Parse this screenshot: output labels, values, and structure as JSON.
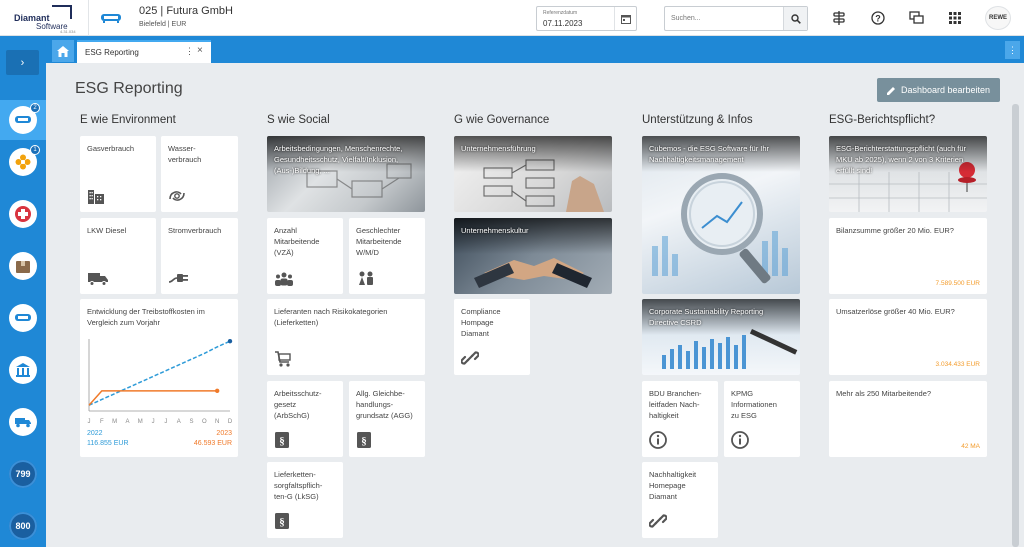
{
  "header": {
    "logo": {
      "line1": "Diamant",
      "line2": "Software",
      "version": "4.31.034"
    },
    "company": "025 | Futura GmbH",
    "company_sub": "Bielefeld | EUR",
    "ref_date_label": "Referenzdatum",
    "ref_date_value": "07.11.2023",
    "search_placeholder": "Suchen...",
    "user_badge": "REWE"
  },
  "sidebar": {
    "badges": [
      "2",
      "1"
    ],
    "numbers": [
      "799",
      "800"
    ]
  },
  "tabs": [
    {
      "label": "ESG Reporting"
    }
  ],
  "page": {
    "title": "ESG Reporting",
    "dashboard_button": "Dashboard bearbeiten"
  },
  "columns": {
    "environment": {
      "title": "E wie Environment",
      "tiles": [
        "Gasverbrauch",
        "Wasser-\nverbrauch",
        "LKW Diesel",
        "Stromverbrauch"
      ],
      "chart_tile": "Entwicklung der Treibstoffkosten im Vergleich zum Vorjahr"
    },
    "social": {
      "title": "S wie Social",
      "image_tile": "Arbeitsbedingungen, Menschenrechte, Gesundheitsschutz, Vielfalt/Inklusion, (Aus-)Bildung, ...",
      "tiles": [
        "Anzahl\nMitarbeitende\n(VZÄ)",
        "Geschlechter\nMitarbeitende\nW/M/D",
        "Lieferanten nach Risikokategorien (Lieferketten)",
        "Arbeitsschutz-\ngesetz\n(ArbSchG)",
        "Allg. Gleichbe-\nhandlungs-\ngrundsatz (AGG)",
        "Lieferketten-\nsorgfaltspflich-\nten-G (LkSG)"
      ]
    },
    "governance": {
      "title": "G wie Governance",
      "image_tiles": [
        "Unternehmensführung",
        "Unternehmenskultur"
      ],
      "tiles": [
        "Compliance\nHompage\nDiamant"
      ]
    },
    "support": {
      "title": "Unterstützung & Infos",
      "image_tiles": [
        "Cubemos - die ESG Software für Ihr Nachhaltigkeitsmanagement",
        "Corporate Sustainability Reporting Directive CSRD"
      ],
      "tiles": [
        "BDU Branchen-\nleitfaden Nach-\nhaltigkeit",
        "KPMG\nInformationen\nzu ESG",
        "Nachhaltigkeit\nHomepage\nDiamant"
      ]
    },
    "obligation": {
      "title": "ESG-Berichtspflicht?",
      "image_tile": "ESG-Berichterstattungspflicht (auch für MKU ab 2025), wenn 2 von 3 Kriterien erfüllt sind!",
      "tiles": [
        {
          "label": "Bilanzsumme größer 20 Mio. EUR?",
          "value": "7.589.500 EUR"
        },
        {
          "label": "Umsatzerlöse größer 40 Mio. EUR?",
          "value": "3.034.433 EUR"
        },
        {
          "label": "Mehr als 250 Mitarbeitende?",
          "value": "42 MA"
        }
      ]
    }
  },
  "chart_data": {
    "type": "line",
    "categories": [
      "J",
      "F",
      "M",
      "A",
      "M",
      "J",
      "J",
      "A",
      "S",
      "O",
      "N",
      "D"
    ],
    "series": [
      {
        "name": "2022",
        "total": "116.855 EUR",
        "color": "#2e9bd8",
        "values": [
          0.08,
          0.16,
          0.24,
          0.32,
          0.4,
          0.48,
          0.56,
          0.64,
          0.72,
          0.8,
          0.89,
          0.97
        ]
      },
      {
        "name": "2023",
        "total": "46.593 EUR",
        "color": "#f07a2a",
        "values": [
          0.08,
          0.28,
          0.28,
          0.28,
          0.28,
          0.28,
          0.28,
          0.28,
          0.28,
          0.28,
          0.28
        ]
      }
    ],
    "ylim": [
      0,
      1
    ]
  },
  "colors": {
    "accent": "#1f88d6",
    "orange": "#f39c2c",
    "button": "#78909c"
  }
}
